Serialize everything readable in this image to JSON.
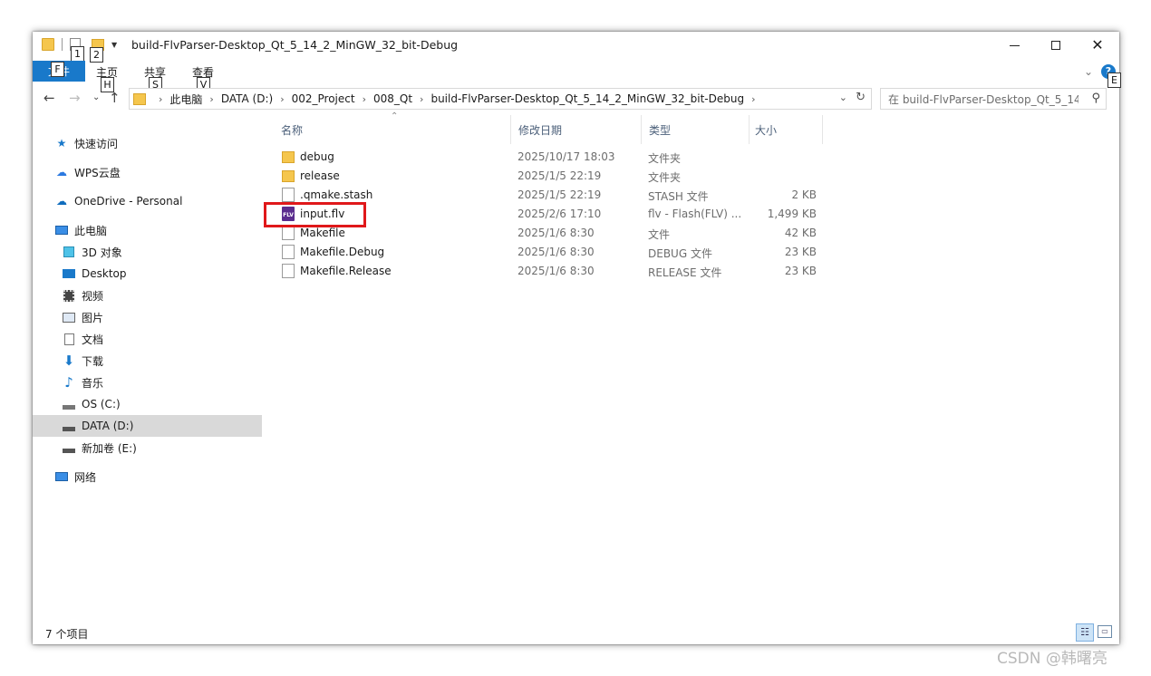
{
  "window": {
    "title": "build-FlvParser-Desktop_Qt_5_14_2_MinGW_32_bit-Debug",
    "keytips": {
      "file": "F",
      "qat1": "1",
      "qat2": "2",
      "home": "H",
      "share": "S",
      "view": "V",
      "help": "E"
    }
  },
  "ribbon": {
    "file_tab": "文件",
    "tabs": [
      "主页",
      "共享",
      "查看"
    ],
    "collapse": "⌄",
    "help": "?"
  },
  "address": {
    "crumbs": [
      "此电脑",
      "DATA (D:)",
      "002_Project",
      "008_Qt",
      "build-FlvParser-Desktop_Qt_5_14_2_MinGW_32_bit-Debug"
    ],
    "search_placeholder": "在 build-FlvParser-Desktop_Qt_5_14..."
  },
  "nav": {
    "items": [
      {
        "label": "快速访问",
        "icon": "star-icon"
      },
      {
        "label": "WPS云盘",
        "icon": "cloud-icon"
      },
      {
        "label": "OneDrive - Personal",
        "icon": "onedrive-icon"
      },
      {
        "label": "此电脑",
        "icon": "computer-icon"
      },
      {
        "label": "3D 对象",
        "icon": "cube-icon"
      },
      {
        "label": "Desktop",
        "icon": "desktop-icon"
      },
      {
        "label": "视频",
        "icon": "video-icon"
      },
      {
        "label": "图片",
        "icon": "picture-icon"
      },
      {
        "label": "文档",
        "icon": "document-icon"
      },
      {
        "label": "下载",
        "icon": "download-icon"
      },
      {
        "label": "音乐",
        "icon": "music-icon"
      },
      {
        "label": "OS (C:)",
        "icon": "drive-icon"
      },
      {
        "label": "DATA (D:)",
        "icon": "drive-icon"
      },
      {
        "label": "新加卷 (E:)",
        "icon": "drive-icon"
      },
      {
        "label": "网络",
        "icon": "network-icon"
      }
    ]
  },
  "columns": [
    "名称",
    "修改日期",
    "类型",
    "大小"
  ],
  "files": [
    {
      "name": "debug",
      "date": "2025/10/17 18:03",
      "type": "文件夹",
      "size": "",
      "icon": "folder-icon"
    },
    {
      "name": "release",
      "date": "2025/1/5 22:19",
      "type": "文件夹",
      "size": "",
      "icon": "folder-icon"
    },
    {
      "name": ".qmake.stash",
      "date": "2025/1/5 22:19",
      "type": "STASH 文件",
      "size": "2 KB",
      "icon": "file-icon"
    },
    {
      "name": "input.flv",
      "date": "2025/2/6 17:10",
      "type": "flv - Flash(FLV) ...",
      "size": "1,499 KB",
      "icon": "flv-icon"
    },
    {
      "name": "Makefile",
      "date": "2025/1/6 8:30",
      "type": "文件",
      "size": "42 KB",
      "icon": "file-icon"
    },
    {
      "name": "Makefile.Debug",
      "date": "2025/1/6 8:30",
      "type": "DEBUG 文件",
      "size": "23 KB",
      "icon": "file-icon"
    },
    {
      "name": "Makefile.Release",
      "date": "2025/1/6 8:30",
      "type": "RELEASE 文件",
      "size": "23 KB",
      "icon": "file-icon"
    }
  ],
  "flv_icon_text": "FLV",
  "status": {
    "count": "7 个项目"
  },
  "watermark": "CSDN @韩曙亮",
  "colors": {
    "accent": "#1979ca",
    "highlight": "#e0181a",
    "selected": "#d9d9d9"
  }
}
